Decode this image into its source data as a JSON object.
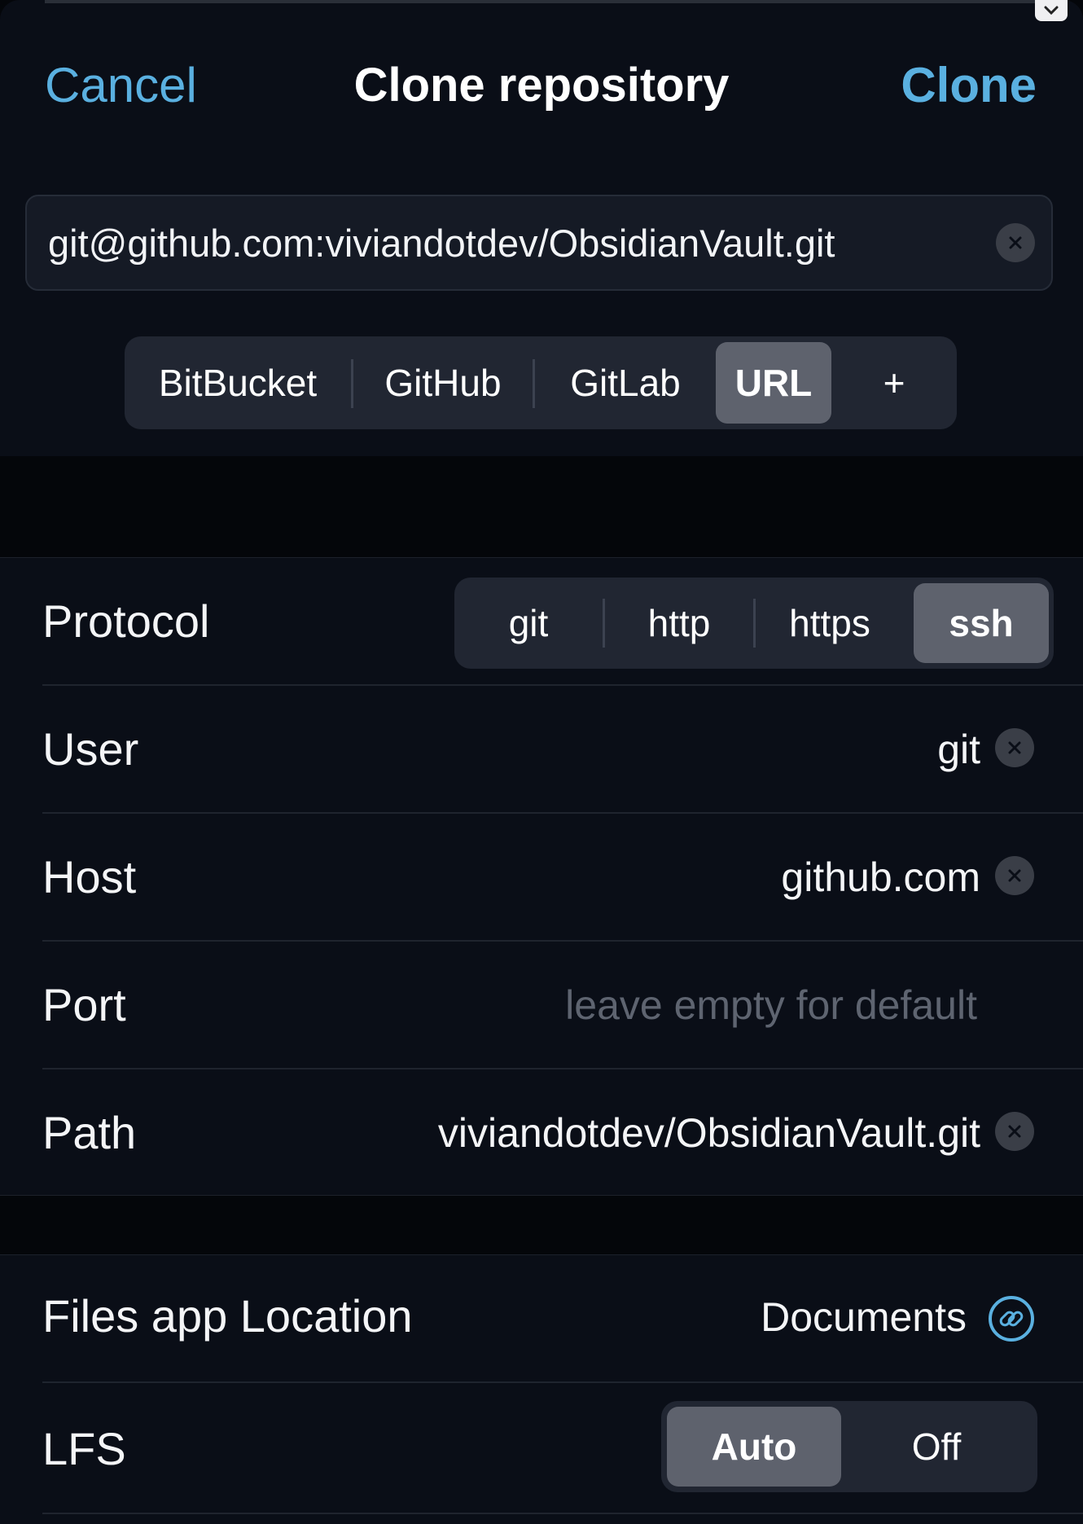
{
  "nav": {
    "cancel_label": "Cancel",
    "title": "Clone repository",
    "clone_label": "Clone"
  },
  "url_field": {
    "value": "git@github.com:viviandotdev/ObsidianVault.git"
  },
  "source_tabs": {
    "items": [
      "BitBucket",
      "GitHub",
      "GitLab",
      "URL",
      "+"
    ],
    "selected": "URL"
  },
  "fields": {
    "protocol": {
      "label": "Protocol",
      "options": [
        "git",
        "http",
        "https",
        "ssh"
      ],
      "selected": "ssh"
    },
    "user": {
      "label": "User",
      "value": "git"
    },
    "host": {
      "label": "Host",
      "value": "github.com"
    },
    "port": {
      "label": "Port",
      "value": "",
      "placeholder": "leave empty for default"
    },
    "path": {
      "label": "Path",
      "value": "viviandotdev/ObsidianVault.git"
    }
  },
  "location": {
    "files_label": "Files app Location",
    "files_value": "Documents",
    "lfs_label": "LFS",
    "lfs_options": [
      "Auto",
      "Off"
    ],
    "lfs_selected": "Auto"
  },
  "colors": {
    "accent": "#5ab0e0",
    "background": "#0a0e17",
    "segment_bg": "#212632",
    "segment_selected": "#5e626d"
  },
  "icons": {
    "clear": "clear-icon",
    "link": "link-icon",
    "dismiss": "chevron-down-icon"
  }
}
